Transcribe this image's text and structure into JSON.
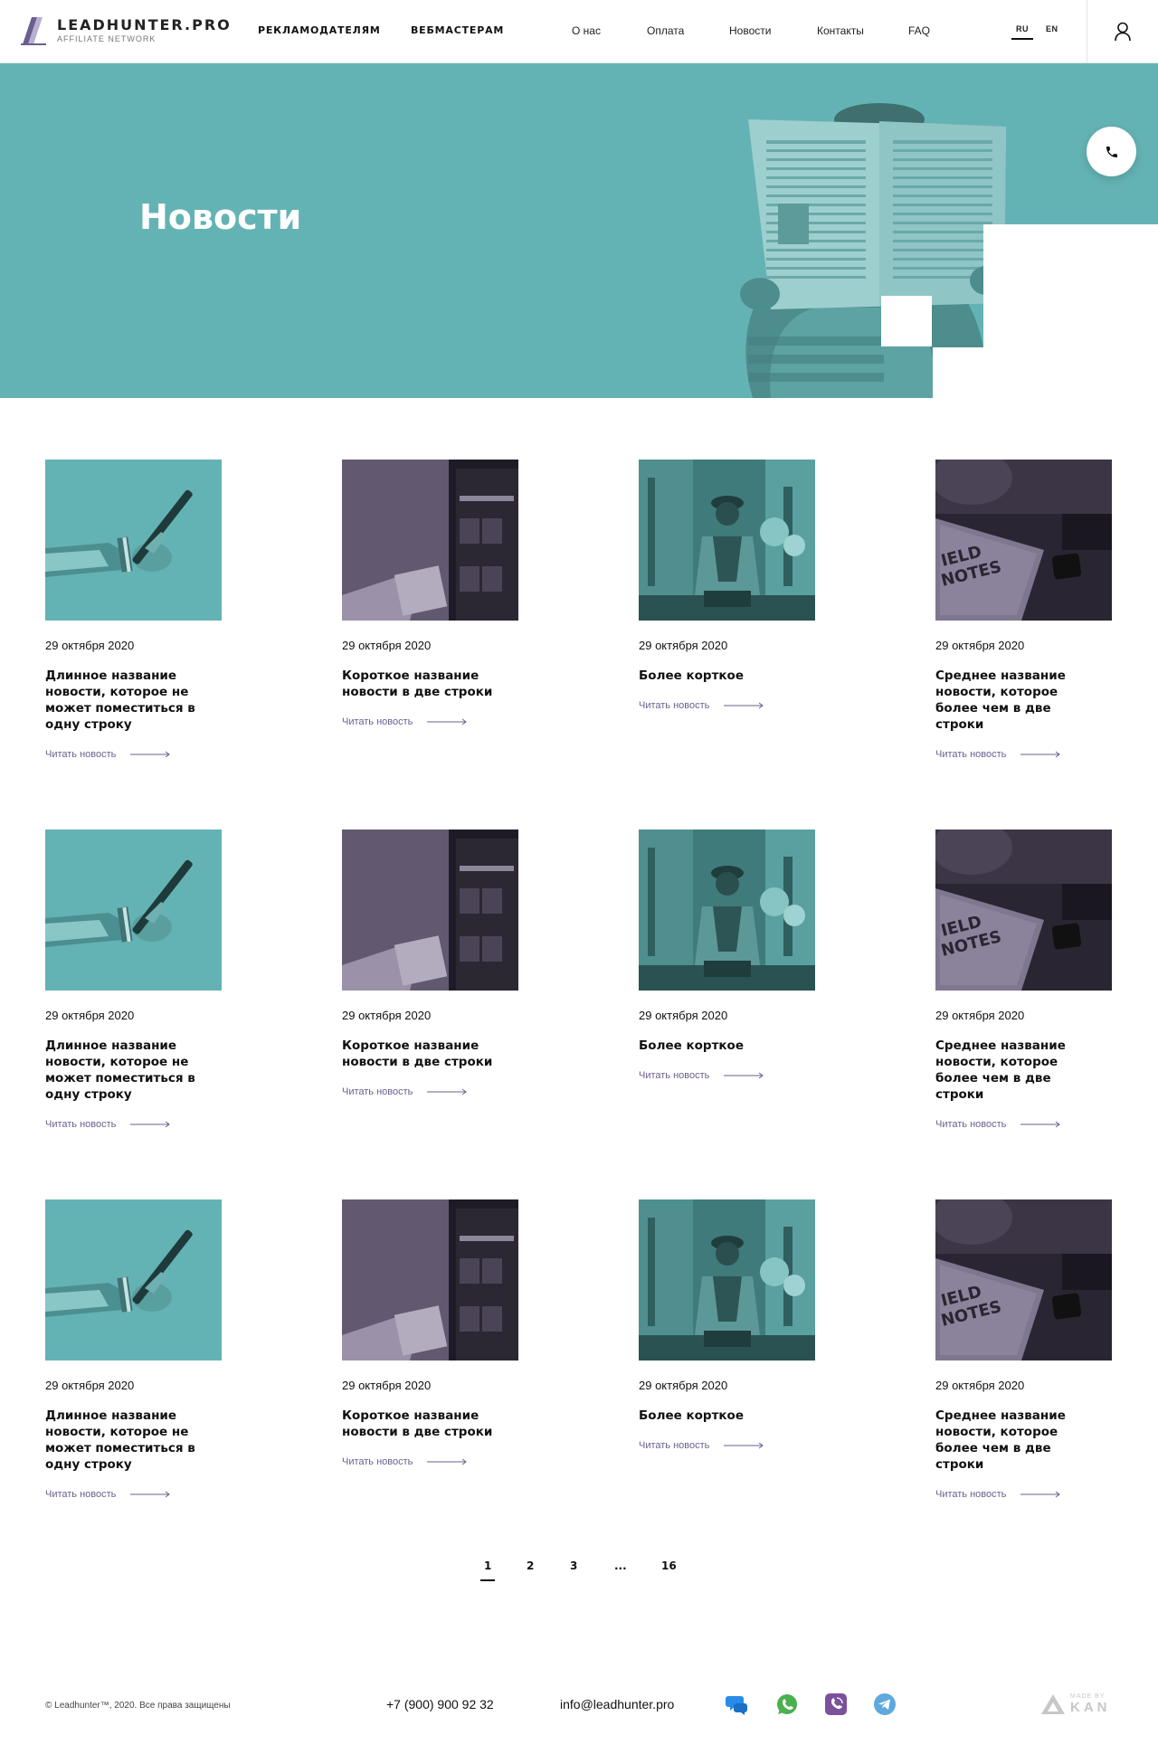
{
  "header": {
    "logo_name": "LEADHUNTER.PRO",
    "logo_sub": "AFFILIATE NETWORK",
    "nav_main": [
      "РЕКЛАМОДАТЕЛЯМ",
      "ВЕБМАСТЕРАМ"
    ],
    "nav_secondary": [
      "О нас",
      "Оплата",
      "Новости",
      "Контакты",
      "FAQ"
    ],
    "languages": [
      "RU",
      "EN"
    ],
    "active_language": "RU"
  },
  "hero": {
    "title": "Новости"
  },
  "news": {
    "rows": [
      [
        {
          "date": "29 октября 2020",
          "title": "Длинное название новости, которое не может поместиться в одну строку",
          "link": "Читать новость",
          "image": "hand-with-phone"
        },
        {
          "date": "29 октября 2020",
          "title": "Короткое название новости в две строки",
          "link": "Читать новость",
          "image": "phone-app-screen"
        },
        {
          "date": "29 октября 2020",
          "title": "Более корткое",
          "link": "Читать новость",
          "image": "man-sitting-street"
        },
        {
          "date": "29 октября 2020",
          "title": "Среднее название новости, которое более чем в две строки",
          "link": "Читать новость",
          "image": "field-notes-notebook"
        }
      ],
      [
        {
          "date": "29 октября 2020",
          "title": "Длинное название новости, которое не может поместиться в одну строку",
          "link": "Читать новость",
          "image": "hand-with-phone"
        },
        {
          "date": "29 октября 2020",
          "title": "Короткое название новости в две строки",
          "link": "Читать новость",
          "image": "phone-app-screen"
        },
        {
          "date": "29 октября 2020",
          "title": "Более корткое",
          "link": "Читать новость",
          "image": "man-sitting-street"
        },
        {
          "date": "29 октября 2020",
          "title": "Среднее название новости, которое более чем в две строки",
          "link": "Читать новость",
          "image": "field-notes-notebook"
        }
      ],
      [
        {
          "date": "29 октября 2020",
          "title": "Длинное название новости, которое не может поместиться в одну строку",
          "link": "Читать новость",
          "image": "hand-with-phone"
        },
        {
          "date": "29 октября 2020",
          "title": "Короткое название новости в две строки",
          "link": "Читать новость",
          "image": "phone-app-screen"
        },
        {
          "date": "29 октября 2020",
          "title": "Более корткое",
          "link": "Читать новость",
          "image": "man-sitting-street"
        },
        {
          "date": "29 октября 2020",
          "title": "Среднее название новости, которое более чем в две строки",
          "link": "Читать новость",
          "image": "field-notes-notebook"
        }
      ]
    ]
  },
  "pagination": {
    "pages": [
      "1",
      "2",
      "3",
      "...",
      "16"
    ],
    "current": "1"
  },
  "footer": {
    "copyright": "© Leadhunter™, 2020. Все права защищены",
    "phone": "+7 (900) 900 92 32",
    "email": "info@leadhunter.pro",
    "socials": [
      "chat-icon",
      "whatsapp-icon",
      "viber-icon",
      "telegram-icon"
    ],
    "made_by_small": "MADE BY",
    "made_by_big": "KAN"
  },
  "colors": {
    "teal": "#64b3b4",
    "purple": "#6b5f8f",
    "dark": "#111111"
  }
}
